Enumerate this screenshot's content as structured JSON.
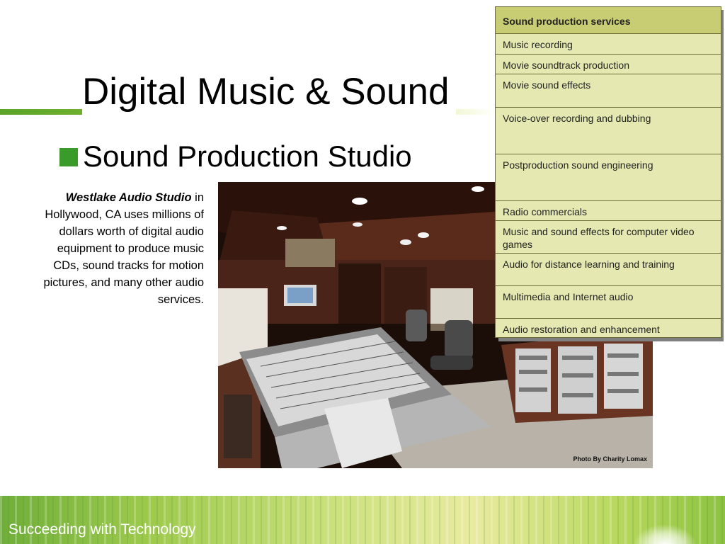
{
  "slide": {
    "title": "Digital Music & Sound",
    "bullet": "Sound Production Studio",
    "caption_bold": "Westlake Audio Studio",
    "caption_rest": " in Hollywood, CA uses millions of dollars worth of digital audio equipment to produce music CDs, sound tracks for motion pictures, and many other audio services.",
    "photo_credit": "Photo By Charity Lomax",
    "footer": "Succeeding with Technology"
  },
  "services_table": {
    "header": "Sound production services",
    "rows": [
      "Music recording",
      "Movie soundtrack production",
      "Movie sound effects",
      "Voice-over recording and dubbing",
      "Postproduction sound engineering",
      "Radio commercials",
      "Music and sound effects for computer video games",
      "Audio for distance learning and training",
      "Multimedia and Internet audio",
      "Audio restoration and enhancement"
    ]
  },
  "colors": {
    "accent_green": "#3a9a2a",
    "table_fill": "#e5e8b0",
    "table_header": "#c8cc72"
  }
}
